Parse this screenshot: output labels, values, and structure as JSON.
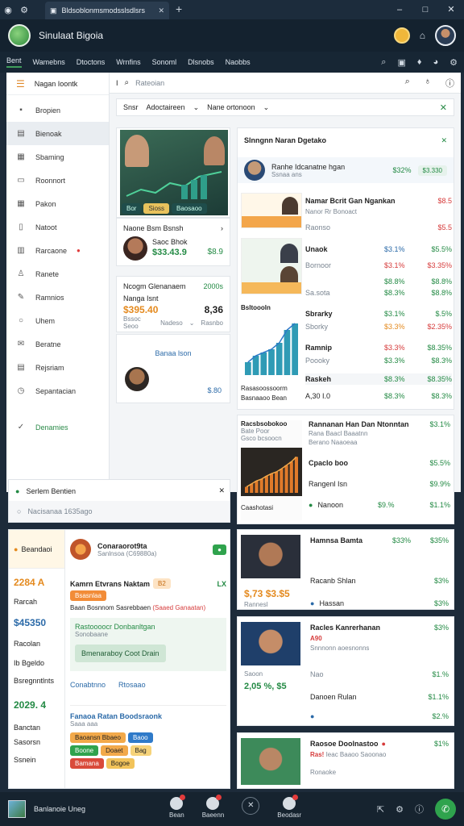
{
  "window": {
    "tab_title": "Bldsoblonmsmodsslsdlsrs",
    "new_tab": "+",
    "controls": [
      "–",
      "□",
      "✕"
    ]
  },
  "app": {
    "title": "Sinulaat Bigoia",
    "icons": [
      "coin-icon",
      "bag-icon",
      "avatar-icon"
    ]
  },
  "menu": {
    "items": [
      "Bent",
      "Wamebns",
      "Dtoctons",
      "Wrnfins",
      "Sonoml",
      "Dlsnobs",
      "Naobbs"
    ],
    "right_icons": [
      "search-icon",
      "bag-icon",
      "tag-icon",
      "user-icon",
      "settings-icon"
    ]
  },
  "sidebar": {
    "header": "Nagan Ioontk",
    "items": [
      {
        "label": "Bropien",
        "icon": "briefcase-icon"
      },
      {
        "label": "Bienoak",
        "icon": "list-icon",
        "active": true
      },
      {
        "label": "Sbaming",
        "icon": "grid-icon"
      },
      {
        "label": "Roonnort",
        "icon": "calendar-icon"
      },
      {
        "label": "Pakon",
        "icon": "grid-icon"
      },
      {
        "label": "Natoot",
        "icon": "document-icon"
      },
      {
        "label": "Rarcaone",
        "icon": "chart-icon",
        "badge": "●"
      },
      {
        "label": "Ranete",
        "icon": "user-icon"
      },
      {
        "label": "Ramnios",
        "icon": "edit-icon"
      },
      {
        "label": "Uhem",
        "icon": "search-icon"
      },
      {
        "label": "Beratne",
        "icon": "mail-icon"
      },
      {
        "label": "Rejsriam",
        "icon": "document-icon"
      },
      {
        "label": "Sepantacian",
        "icon": "clock-icon"
      }
    ],
    "footer": "Denamies"
  },
  "search": {
    "placeholder": "Rateoian",
    "icons": [
      "search-icon",
      "pin-icon",
      "info-icon"
    ]
  },
  "filter": {
    "label": "Snsr",
    "select1": "Adoctaireen",
    "select2": "Nane ortonoon"
  },
  "left_col": {
    "card1": {
      "title": "Naone Bsm Bsnsh",
      "badges": [
        "Bor",
        "Sioss",
        "Baosaoo"
      ]
    },
    "card2": {
      "name": "Saoc Bhok",
      "value": "$33.43.9",
      "side": "$8.9"
    },
    "card3": {
      "title": "Ncogm Glenanaem",
      "tag": "2000s",
      "sub": "Nanga Isnt",
      "amount": "$395.40",
      "side": "8,36",
      "meta1": "Bssoc Seoo",
      "meta2": "Nadeso",
      "meta3": "Rasnbo"
    },
    "card4": {
      "link": "Banaa lson",
      "amount": "$.80"
    }
  },
  "right_panel": {
    "title": "Slnngnn Naran Dgetako",
    "header_row": {
      "name": "Ranhe Idcanatne hgan",
      "sub": "Ssnaa ans",
      "v1": "$32%",
      "v2": "$3.330"
    },
    "rows": [
      {
        "name": "Namar Bcrit Gan Ngankan",
        "sub": "Nanor Rr Bonoact",
        "v1": "$8.5",
        "v2": "$5.5"
      },
      {
        "name": "Unaok",
        "v1": "$3.1%",
        "v2": "$5.5%"
      },
      {
        "name": "Bornoor",
        "v1": "$3.1%",
        "v2": "$3.35%"
      },
      {
        "name": "",
        "v1": "$8.8%",
        "v2": "$8.8%"
      },
      {
        "name": "Sa.sota",
        "v1": "$8.3%",
        "v2": "$8.8%"
      },
      {
        "name": "Sbrarky",
        "v1": "$3.1%",
        "v2": "$.5%"
      },
      {
        "name": "Sborky",
        "v1": "$3.3%",
        "v2": "$2.35%"
      },
      {
        "name": "Ramnip",
        "v1": "$3.3%",
        "v2": "$8.35%"
      },
      {
        "name": "Poooky",
        "v1": "$3.3%",
        "v2": "$8.3%"
      },
      {
        "name": "Raskeh",
        "v1": "$8.3%",
        "v2": "$8.35%"
      },
      {
        "name": "A,30 I.0",
        "v1": "$8.3%",
        "v2": "$8.3%"
      }
    ],
    "bottom_card": {
      "title": "Rannanan Han Dan Ntonntan",
      "sub": "Rana Baacl Baaatnn",
      "sub2": "Berano Naaoeaa",
      "tag": "$3.1%",
      "r1": "Cpaclo boo",
      "r1v": "$5.5%",
      "r2": "Rangenl Isn",
      "r2v": "$9.9%",
      "r3": "Nanoon",
      "r3v1": "$9.%",
      "r3v2": "$1.1%"
    }
  },
  "chart_panel": {
    "title": "Bsltoooln",
    "subtitle": "Rasasoossoorm",
    "caption": "Basnaaoo Bean",
    "chart_data": {
      "type": "bar",
      "values": [
        2,
        3,
        3.5,
        4,
        5,
        7,
        8
      ],
      "ylim": [
        0,
        9
      ]
    }
  },
  "chart_panel2": {
    "title": "Racsbsobokoo",
    "sub": "Bate Poor",
    "sub2": "Gsco bcsoocn",
    "footer": "Caashotasi",
    "chart_data": {
      "type": "bar",
      "values": [
        1,
        1.5,
        2,
        2.3,
        2.8,
        3.2,
        3.5,
        4,
        4.6,
        5.2,
        6
      ],
      "ylim": [
        0,
        7
      ]
    }
  },
  "overlay_notice": {
    "title": "Serlem Bentien",
    "sub": "Nacisanaa 1635ago"
  },
  "detail": {
    "avatar_label": "Beandaoi",
    "name": "Conaraorot9ta",
    "sub": "Sanlnsoa (C69880a)",
    "badge": "●",
    "date": "2284 A",
    "date_label": "Rarcah",
    "amount": "$45350",
    "amount_label": "Racolan",
    "meta1": "Ib Bgeldo",
    "meta2": "Bsregnntlnts",
    "date2": "2029. 4",
    "date2_label": "Banctan",
    "meta3": "Sasorsn",
    "meta4": "Ssnein",
    "title": "Kamrn Etvrans Naktam",
    "title_badge": "B2",
    "title_right": "LX",
    "title_tag": "Bsasnlaa",
    "line": "Baan Bosnnom Sasrebbaen",
    "line_tag": "(Saaed Ganaatan)",
    "box_title": "Rastoooocr Donbanltgan",
    "box_sub": "Sonobaane",
    "btn": "Bmenaraboy Coot Drain",
    "link1": "Conabtnno",
    "link2": "Rtosaao",
    "sec_title": "Fanaoa Ratan Boodsraonk",
    "sec_sub": "Saaa aaa",
    "pills": [
      "Baoansn Bbaeo",
      "Baoo",
      "Boone",
      "Doaet",
      "Bag",
      "Bamana",
      "Bogoe"
    ]
  },
  "right_bottom": {
    "card1": {
      "name": "Hamnsa Bamta",
      "v1": "$33%",
      "v2": "$35%",
      "amount": "$,73 $3.$5",
      "amt_tag": "Rannesl",
      "r2": "Racanb Shlan",
      "r2v": "$3%",
      "r3": "Hassan",
      "r3v": "$3%"
    },
    "card2": {
      "name": "Racles Kanrerhanan",
      "v1": "$3%",
      "tag": "A90",
      "sub": "Snnnonn aoesnonns",
      "r2": "Saoon",
      "r2v": "$1.%",
      "amount": "2,05 %, $5",
      "r3": "Danoen Rulan",
      "r3v": "$1.1%",
      "r4": "Nao",
      "r4v": "$2.%"
    },
    "card3": {
      "name": "Raosoe Doolnastoo",
      "v1": "$1%",
      "tag": "Ras!",
      "sub": "Ieac Baaoo Saoonao",
      "r2": "Ronaoke"
    }
  },
  "taskbar": {
    "app_label": "Banlanoie Uneg",
    "items": [
      "Bean",
      "Baeenn",
      "Beodasr"
    ],
    "close": "✕"
  }
}
